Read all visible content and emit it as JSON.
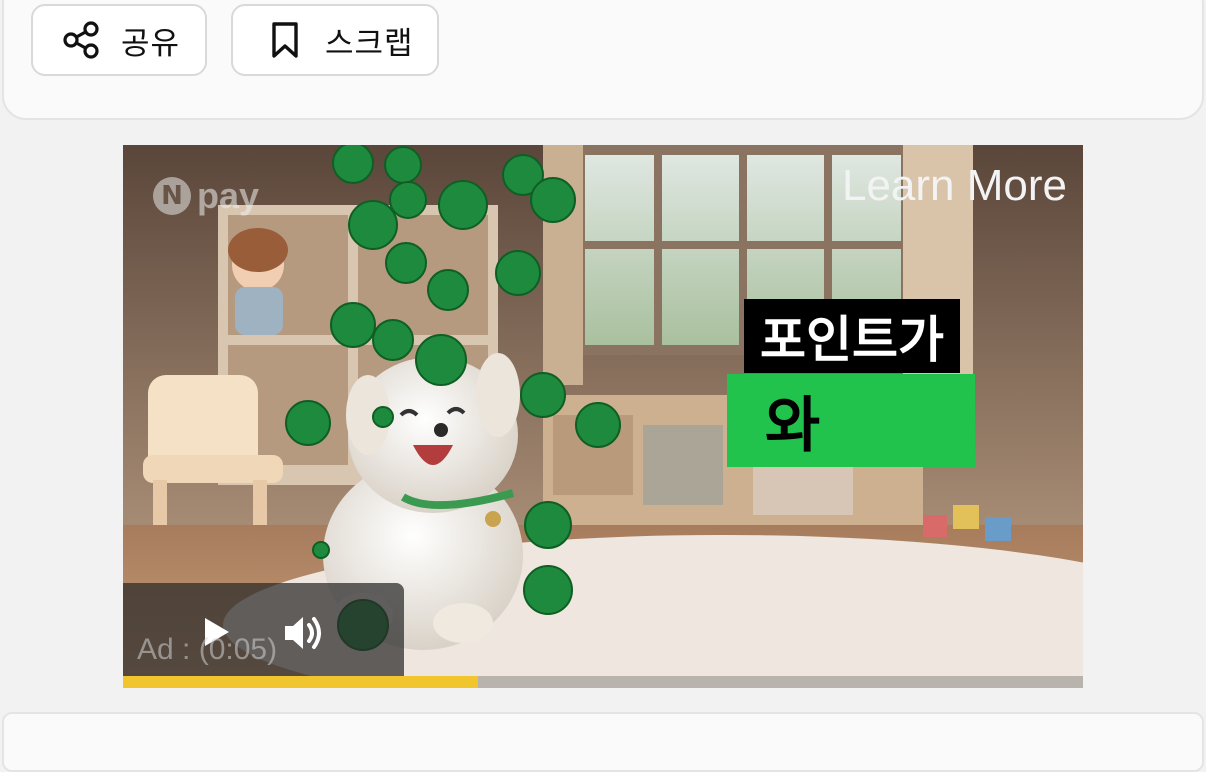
{
  "toolbar": {
    "share_label": "공유",
    "share_icon": "share-icon",
    "scrap_label": "스크랩",
    "scrap_icon": "bookmark-icon"
  },
  "video_ad": {
    "brand_n": "N",
    "brand_pay": "pay",
    "learn_more": "Learn More",
    "caption_line1": "포인트가",
    "caption_line2": "와",
    "ad_label": "Ad : (0:05)",
    "play_icon": "play-icon",
    "volume_icon": "volume-icon",
    "progress_fraction": 0.37,
    "colors": {
      "progress_fill": "#f0c52e",
      "caption_green": "#22c34c",
      "caption_black": "#000000"
    }
  }
}
